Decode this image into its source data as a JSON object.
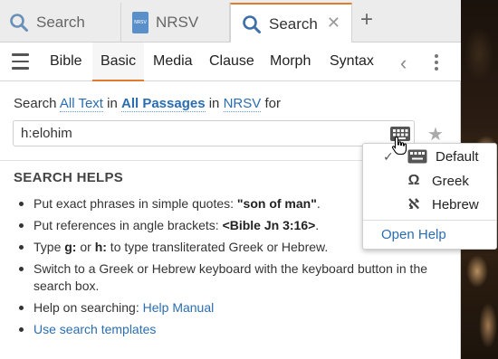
{
  "tabs": [
    {
      "label": "Search",
      "icon": "search-icon"
    },
    {
      "label": "NRSV",
      "icon": "nrsv-book-icon",
      "badge": "NRSV"
    },
    {
      "label": "Search",
      "icon": "search-icon",
      "active": true
    }
  ],
  "nav": {
    "items": [
      "Bible",
      "Basic",
      "Media",
      "Clause",
      "Morph",
      "Syntax"
    ],
    "active": "Basic"
  },
  "search": {
    "prefix": "Search",
    "scope": "All Text",
    "in1": "in",
    "passages": "All Passages",
    "in2": "in",
    "version": "NRSV",
    "suffix": "for",
    "query": "h:elohim"
  },
  "helps": {
    "title": "SEARCH HELPS",
    "item1_text": "Put exact phrases in simple quotes: ",
    "item1_bold": "\"son of man\"",
    "item1_end": ".",
    "item2_text": "Put references in angle brackets: ",
    "item2_bold": "<Bible Jn 3:16>",
    "item2_end": ".",
    "item3_a": "Type ",
    "item3_g": "g:",
    "item3_or": " or ",
    "item3_h": "h:",
    "item3_end": " to type transliterated Greek or Hebrew.",
    "item4": "Switch to a Greek or Hebrew keyboard with the keyboard button in the search box.",
    "item5_text": "Help on searching: ",
    "item5_link": "Help Manual",
    "item6_link": "Use search templates"
  },
  "keyboard_menu": {
    "items": [
      {
        "label": "Default",
        "icon": "keyboard-icon",
        "checked": true
      },
      {
        "label": "Greek",
        "icon": "omega-icon",
        "glyph": "Ω"
      },
      {
        "label": "Hebrew",
        "icon": "aleph-icon",
        "glyph": "ℵ"
      }
    ],
    "help": "Open Help"
  },
  "colors": {
    "accent": "#e37b2e",
    "link": "#2a6db0"
  }
}
